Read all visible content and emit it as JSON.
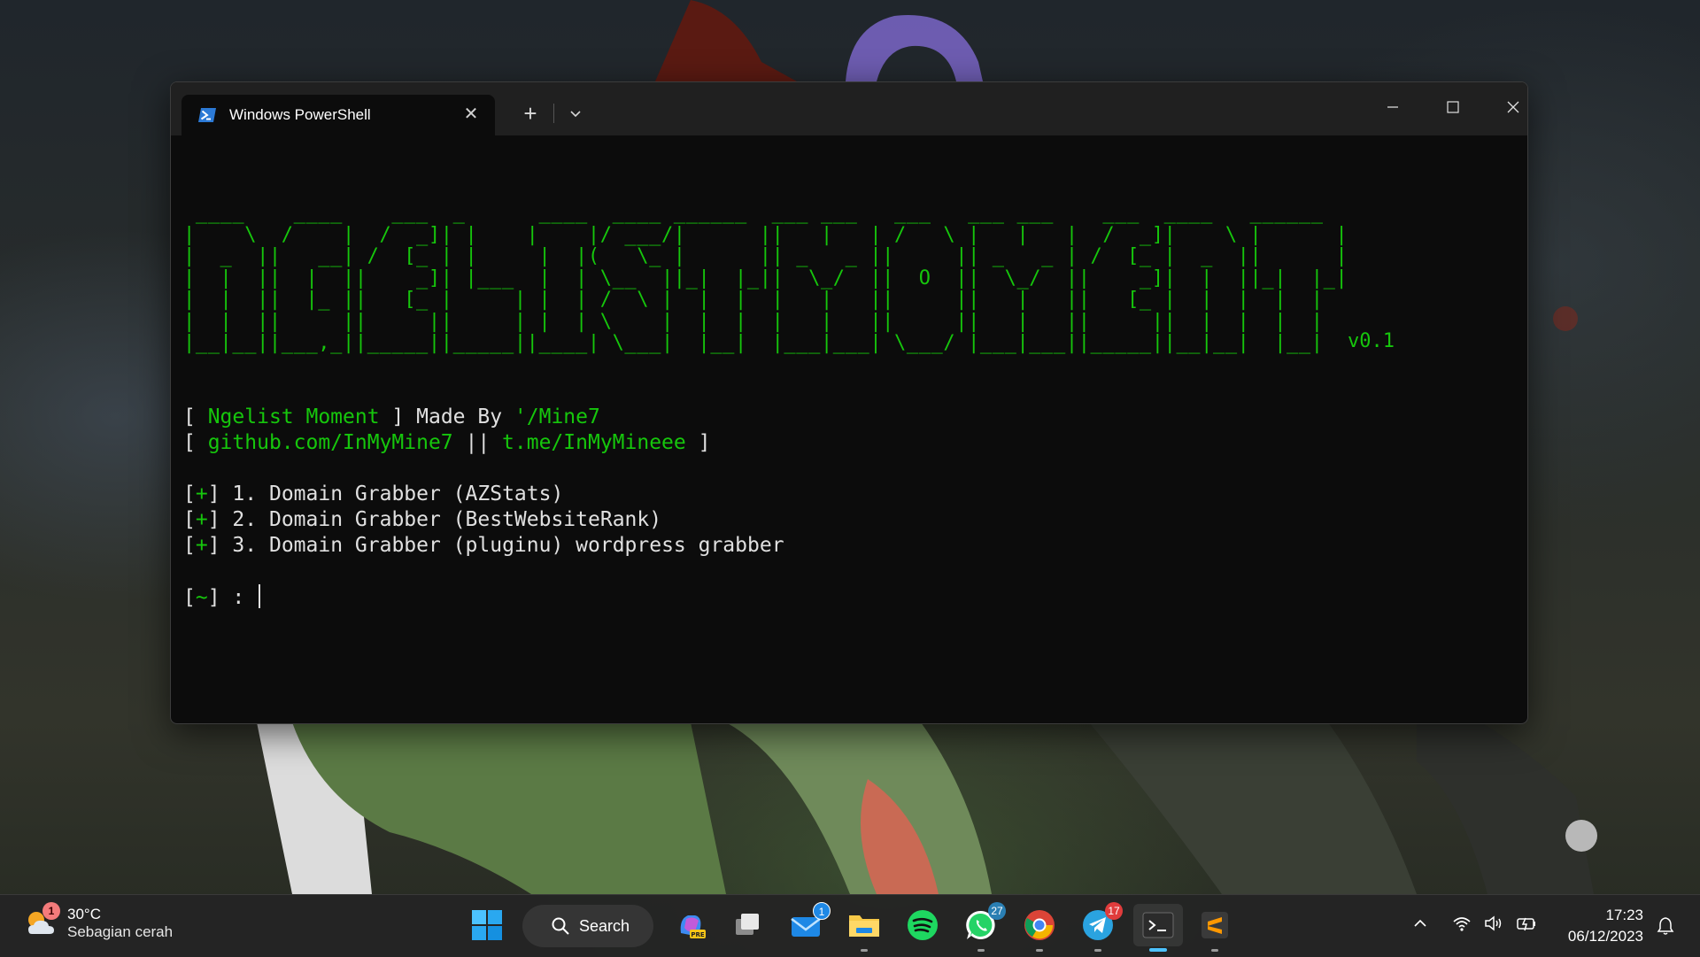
{
  "window": {
    "tab_title": "Windows PowerShell",
    "tab_close": "✕",
    "new_tab": "+",
    "icons": [
      "powershell-icon",
      "chevron-down-icon",
      "minimize-icon",
      "maximize-icon",
      "close-icon"
    ]
  },
  "terminal": {
    "ascii_art": " ____    ____    ___  _      ____  ____ ______  ___ ___   ___   ___ ___    ___  ____   ______ \n|    \\  /    |  /  _]| |    |    |/ ___/|      ||   |   | /   \\ |   |   |  /  _]|    \\ |      |\n|  _  ||   __| /  [_ | |     |  |(   \\_ |      || _   _ ||     || _   _ | /  [_ |  _  ||      |\n|  |  ||  |  ||    _]| |___  |  | \\__  ||_|  |_||  \\_/  ||  O  ||  \\_/  ||    _]|  |  ||_|  |_|\n|  |  ||  |_ ||   [_ |     | |  | /  \\ |  |  |  |   |   ||     ||   |   ||   [_ |  |  |  |  |  \n|  |  ||     ||     ||     | |  | \\    |  |  |  |   |   ||     ||   |   ||     ||  |  |  |  |  \n|__|__||___,_||_____||_____||____| \\___|  |__|  |___|___| \\___/ |___|___||_____||__|__|  |__|  ",
    "version": "v0.1",
    "credit": {
      "open": "[ ",
      "name": "Ngelist Moment",
      "mid": " ] Made By ",
      "author": "'/Mine7"
    },
    "links": {
      "open": "[ ",
      "github": "github.com/InMyMine7",
      "sep": " || ",
      "telegram": "t.me/InMyMineee",
      "close": " ]"
    },
    "menu": [
      {
        "bracket_open": "[",
        "mark": "+",
        "bracket_close": "]",
        "text": " 1. Domain Grabber (AZStats)"
      },
      {
        "bracket_open": "[",
        "mark": "+",
        "bracket_close": "]",
        "text": " 2. Domain Grabber (BestWebsiteRank)"
      },
      {
        "bracket_open": "[",
        "mark": "+",
        "bracket_close": "]",
        "text": " 3. Domain Grabber (pluginu) wordpress grabber"
      }
    ],
    "prompt": {
      "bracket_open": "[",
      "mark": "~",
      "bracket_close": "]",
      "text": " : "
    }
  },
  "taskbar": {
    "weather": {
      "temp": "30°C",
      "desc": "Sebagian cerah",
      "badge": "1"
    },
    "search_label": "Search",
    "apps": [
      {
        "name": "copilot",
        "badge": ""
      },
      {
        "name": "task-view",
        "badge": ""
      },
      {
        "name": "mail",
        "badge": "1"
      },
      {
        "name": "file-explorer",
        "badge": ""
      },
      {
        "name": "spotify",
        "badge": ""
      },
      {
        "name": "whatsapp",
        "badge": "27"
      },
      {
        "name": "chrome",
        "badge": ""
      },
      {
        "name": "telegram",
        "badge": "17"
      },
      {
        "name": "terminal",
        "badge": ""
      },
      {
        "name": "sublime-text",
        "badge": ""
      }
    ],
    "clock": {
      "time": "17:23",
      "date": "06/12/2023"
    },
    "colors": {
      "accent": "#4cc2ff",
      "terminal_green": "#16c60c"
    }
  }
}
